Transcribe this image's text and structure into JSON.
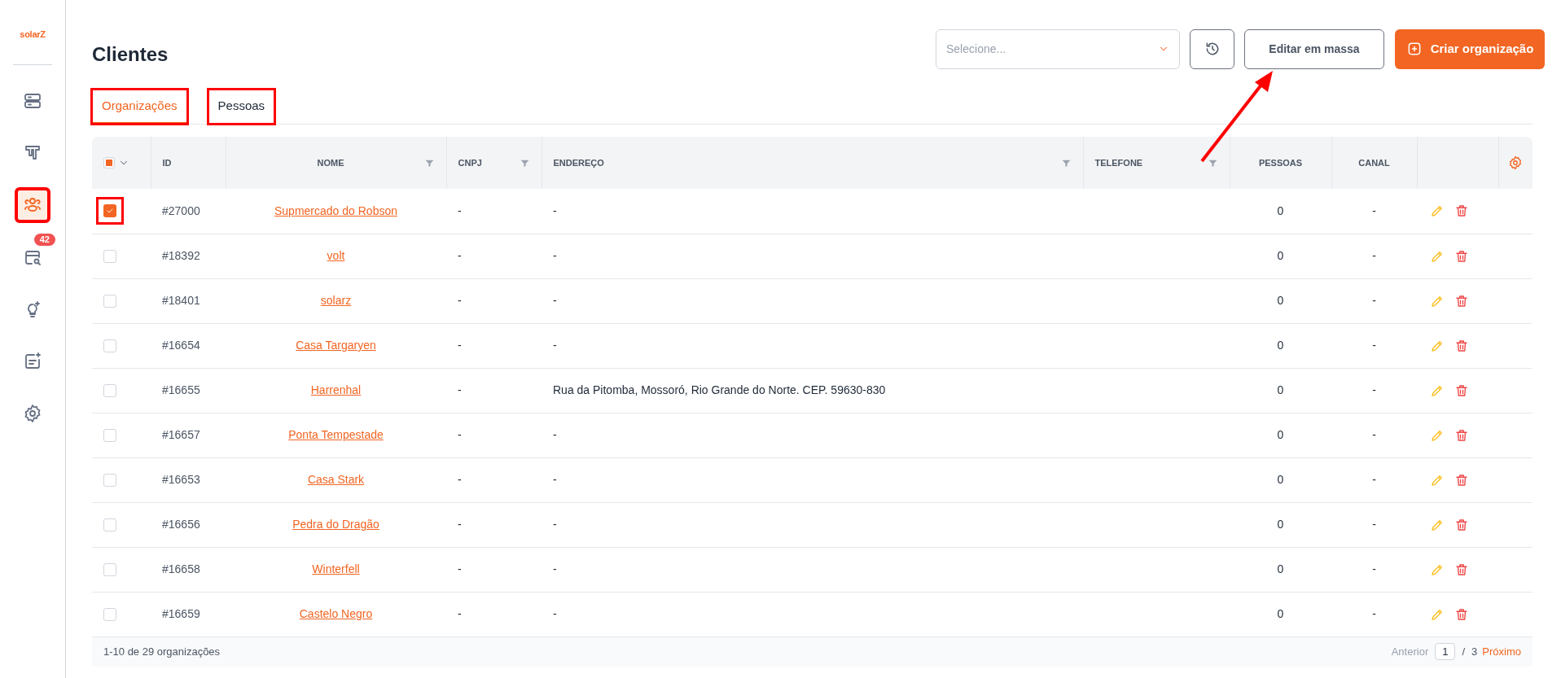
{
  "sidebar": {
    "logo": "solarZ",
    "items": [
      {
        "selected": false,
        "highlighted": false
      },
      {
        "selected": false,
        "highlighted": false
      },
      {
        "selected": true,
        "highlighted": true
      },
      {
        "selected": false,
        "highlighted": false,
        "badge": "42"
      },
      {
        "selected": false,
        "highlighted": false
      },
      {
        "selected": false,
        "highlighted": false
      },
      {
        "selected": false,
        "highlighted": false
      }
    ]
  },
  "header": {
    "title": "Clientes",
    "select": {
      "placeholder": "Selecione..."
    },
    "bulk_edit_button": {
      "label": "Editar em massa",
      "arrow_pointing": true
    },
    "create_button": {
      "label": "Criar organização"
    }
  },
  "tabs": [
    {
      "label": "Organizações",
      "selected": true,
      "highlighted": true
    },
    {
      "label": "Pessoas",
      "selected": false,
      "highlighted": true
    }
  ],
  "table": {
    "header_checkbox": {
      "partial": true
    },
    "columns": [
      {
        "label": "ID",
        "filter": false
      },
      {
        "label": "NOME",
        "filter": true
      },
      {
        "label": "CNPJ",
        "filter": true
      },
      {
        "label": "ENDEREÇO",
        "filter": true
      },
      {
        "label": "TELEFONE",
        "filter": true
      },
      {
        "label": "PESSOAS",
        "filter": false
      },
      {
        "label": "CANAL",
        "filter": false
      }
    ],
    "rows": [
      {
        "checked": true,
        "highlighted": true,
        "id": "#27000",
        "nome": "Supmercado do Robson",
        "cnpj": "-",
        "endereco": "-",
        "telefone": "",
        "pessoas": "0",
        "canal": "-"
      },
      {
        "checked": false,
        "highlighted": false,
        "id": "#18392",
        "nome": "volt",
        "cnpj": "-",
        "endereco": "-",
        "telefone": "",
        "pessoas": "0",
        "canal": "-"
      },
      {
        "checked": false,
        "highlighted": false,
        "id": "#18401",
        "nome": "solarz",
        "cnpj": "-",
        "endereco": "-",
        "telefone": "",
        "pessoas": "0",
        "canal": "-"
      },
      {
        "checked": false,
        "highlighted": false,
        "id": "#16654",
        "nome": "Casa Targaryen",
        "cnpj": "-",
        "endereco": "-",
        "telefone": "",
        "pessoas": "0",
        "canal": "-"
      },
      {
        "checked": false,
        "highlighted": false,
        "id": "#16655",
        "nome": "Harrenhal",
        "cnpj": "-",
        "endereco": "Rua da Pitomba, Mossoró, Rio Grande do Norte. CEP. 59630-830",
        "telefone": "",
        "pessoas": "0",
        "canal": "-"
      },
      {
        "checked": false,
        "highlighted": false,
        "id": "#16657",
        "nome": "Ponta Tempestade",
        "cnpj": "-",
        "endereco": "-",
        "telefone": "",
        "pessoas": "0",
        "canal": "-"
      },
      {
        "checked": false,
        "highlighted": false,
        "id": "#16653",
        "nome": "Casa Stark",
        "cnpj": "-",
        "endereco": "-",
        "telefone": "",
        "pessoas": "0",
        "canal": "-"
      },
      {
        "checked": false,
        "highlighted": false,
        "id": "#16656",
        "nome": "Pedra do Dragão",
        "cnpj": "-",
        "endereco": "-",
        "telefone": "",
        "pessoas": "0",
        "canal": "-"
      },
      {
        "checked": false,
        "highlighted": false,
        "id": "#16658",
        "nome": "Winterfell",
        "cnpj": "-",
        "endereco": "-",
        "telefone": "",
        "pessoas": "0",
        "canal": "-"
      },
      {
        "checked": false,
        "highlighted": false,
        "id": "#16659",
        "nome": "Castelo Negro",
        "cnpj": "-",
        "endereco": "-",
        "telefone": "",
        "pessoas": "0",
        "canal": "-"
      }
    ]
  },
  "footer": {
    "summary": "1-10 de 29 organizações",
    "previous": "Anterior",
    "page": "1",
    "separator": "/",
    "total_pages": "3",
    "next": "Próximo"
  }
}
